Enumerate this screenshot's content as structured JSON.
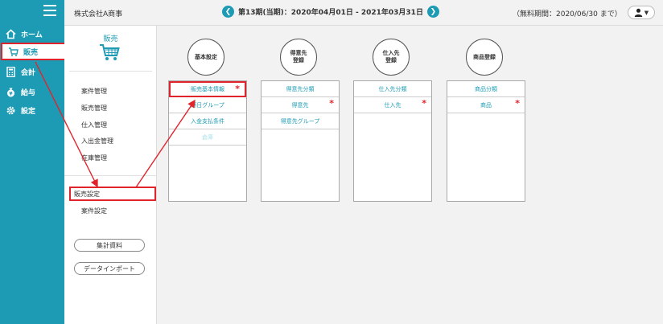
{
  "nav": {
    "items": [
      {
        "label": "ホーム",
        "icon": "home-icon"
      },
      {
        "label": "販売",
        "icon": "cart-icon"
      },
      {
        "label": "会計",
        "icon": "calculator-icon"
      },
      {
        "label": "給与",
        "icon": "money-bag-icon"
      },
      {
        "label": "設定",
        "icon": "gear-icon"
      }
    ],
    "active_index": 1
  },
  "header": {
    "company": "株式会社A商事",
    "period": "第13期(当期)：2020年04月01日 - 2021年03月31日",
    "trial": "（無料期間：2020/06/30 まで）"
  },
  "sidebar": {
    "title": "販売",
    "items": [
      "案件管理",
      "販売管理",
      "仕入管理",
      "入出金管理",
      "在庫管理"
    ],
    "settings": {
      "selected": "販売設定",
      "other": "案件設定"
    },
    "buttons": [
      "集計資料",
      "データインポート"
    ]
  },
  "columns": [
    {
      "title": "基本設定",
      "items": [
        {
          "label": "販売基本情報",
          "required": true,
          "highlighted": true
        },
        {
          "label": "締日グループ"
        },
        {
          "label": "入金支払条件"
        },
        {
          "label": "倉庫",
          "disabled": true
        }
      ]
    },
    {
      "title": "得意先\n登録",
      "items": [
        {
          "label": "得意先分類"
        },
        {
          "label": "得意先",
          "required": true
        },
        {
          "label": "得意先グループ"
        }
      ]
    },
    {
      "title": "仕入先\n登録",
      "items": [
        {
          "label": "仕入先分類"
        },
        {
          "label": "仕入先",
          "required": true
        }
      ]
    },
    {
      "title": "商品登録",
      "items": [
        {
          "label": "商品分類"
        },
        {
          "label": "商品",
          "required": true
        }
      ]
    }
  ],
  "colors": {
    "accent": "#1e9bb4",
    "highlight": "#e0242c",
    "main_bg": "#f2f2f2"
  }
}
